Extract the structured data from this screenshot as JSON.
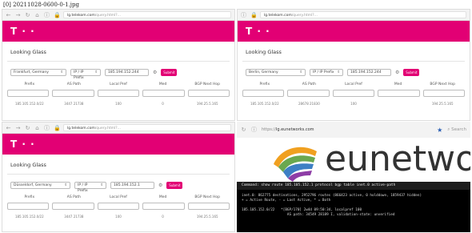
{
  "caption": "[0] 20211028-0600-0-1.jpg",
  "brand_logo": "T · ·",
  "page_title": "Looking Glass",
  "submit_label": "Submit",
  "table_headers": [
    "Prefix",
    "AS Path",
    "Local Pref",
    "Med",
    "BGP Next Hop"
  ],
  "protocol_label": "IP / IP Prefix",
  "panes": [
    {
      "url_host": "lg.telekom.com",
      "url_rest": "/query.html?...",
      "router": "Frankfurt, Germany",
      "ip": "185.194.152.244",
      "row": [
        "185.105.152.0/22",
        "3447 21738",
        "100",
        "0",
        "194.25.5.165"
      ]
    },
    {
      "url_host": "lg.telekom.com",
      "url_rest": "/query.html?...",
      "router": "Berlin, Germany",
      "ip": "185.194.152.244",
      "row": [
        "185.105.152.0/22",
        "28678 21830",
        "100",
        "",
        "194.25.5.165"
      ]
    },
    {
      "url_host": "lg.telekom.com",
      "url_rest": "/query.html?...",
      "router": "Düsseldorf, Germany",
      "ip": "185.194.152.1",
      "row": [
        "185.105.152.0/22",
        "3447 21738",
        "100",
        "0",
        "194.25.5.165"
      ]
    }
  ],
  "eunet": {
    "url_host": "lg.eunetworks.com",
    "url_prefix": "https://",
    "search_label": "Search",
    "logo_text": "eunetwo",
    "command": "Command: show route 185.105.152.1 protocol bgp table inet.0 active-path",
    "terminal": "inet.0: 862775 destinations, 2952796 routes (866423 active, 0 holddown, 1859437 hidden)\n+ = Active Route, - = Last Active, * = Both\n\n185.105.152.0/22   *[BGP/170] 2w4d 09:50:34, localpref 100\n                      AS path: 34549 28189 I, validation-state: unverified"
  }
}
